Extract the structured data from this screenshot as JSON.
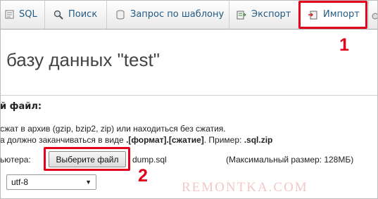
{
  "tabs": [
    {
      "label": "SQL",
      "icon": "sql-icon"
    },
    {
      "label": "Поиск",
      "icon": "search-icon"
    },
    {
      "label": "Запрос по шаблону",
      "icon": "query-template-icon"
    },
    {
      "label": "Экспорт",
      "icon": "export-icon"
    },
    {
      "label": "Импорт",
      "icon": "import-icon"
    }
  ],
  "page": {
    "title": "базу данных \"test\""
  },
  "upload": {
    "section_title": "й файл:",
    "description_line1": "сжат в архив (gzip, bzip2, zip) или находиться без сжатия.",
    "description_line2_pre": "а должно заканчиваться в виде ",
    "description_line2_format": ".[формат].[сжатие]",
    "description_line2_mid": ". Пример: ",
    "description_line2_example": ".sql.zip",
    "browse_label": "ьютера:",
    "browse_button": "Выберите файл",
    "file_name": "dump.sql",
    "max_size": "(Максимальный размер: 128МБ)",
    "charset": "utf-8"
  },
  "annotations": {
    "marker1": "1",
    "marker2": "2",
    "watermark": "REMONTKA.COM"
  },
  "colors": {
    "highlight": "#e3001b",
    "link": "#235a81"
  }
}
